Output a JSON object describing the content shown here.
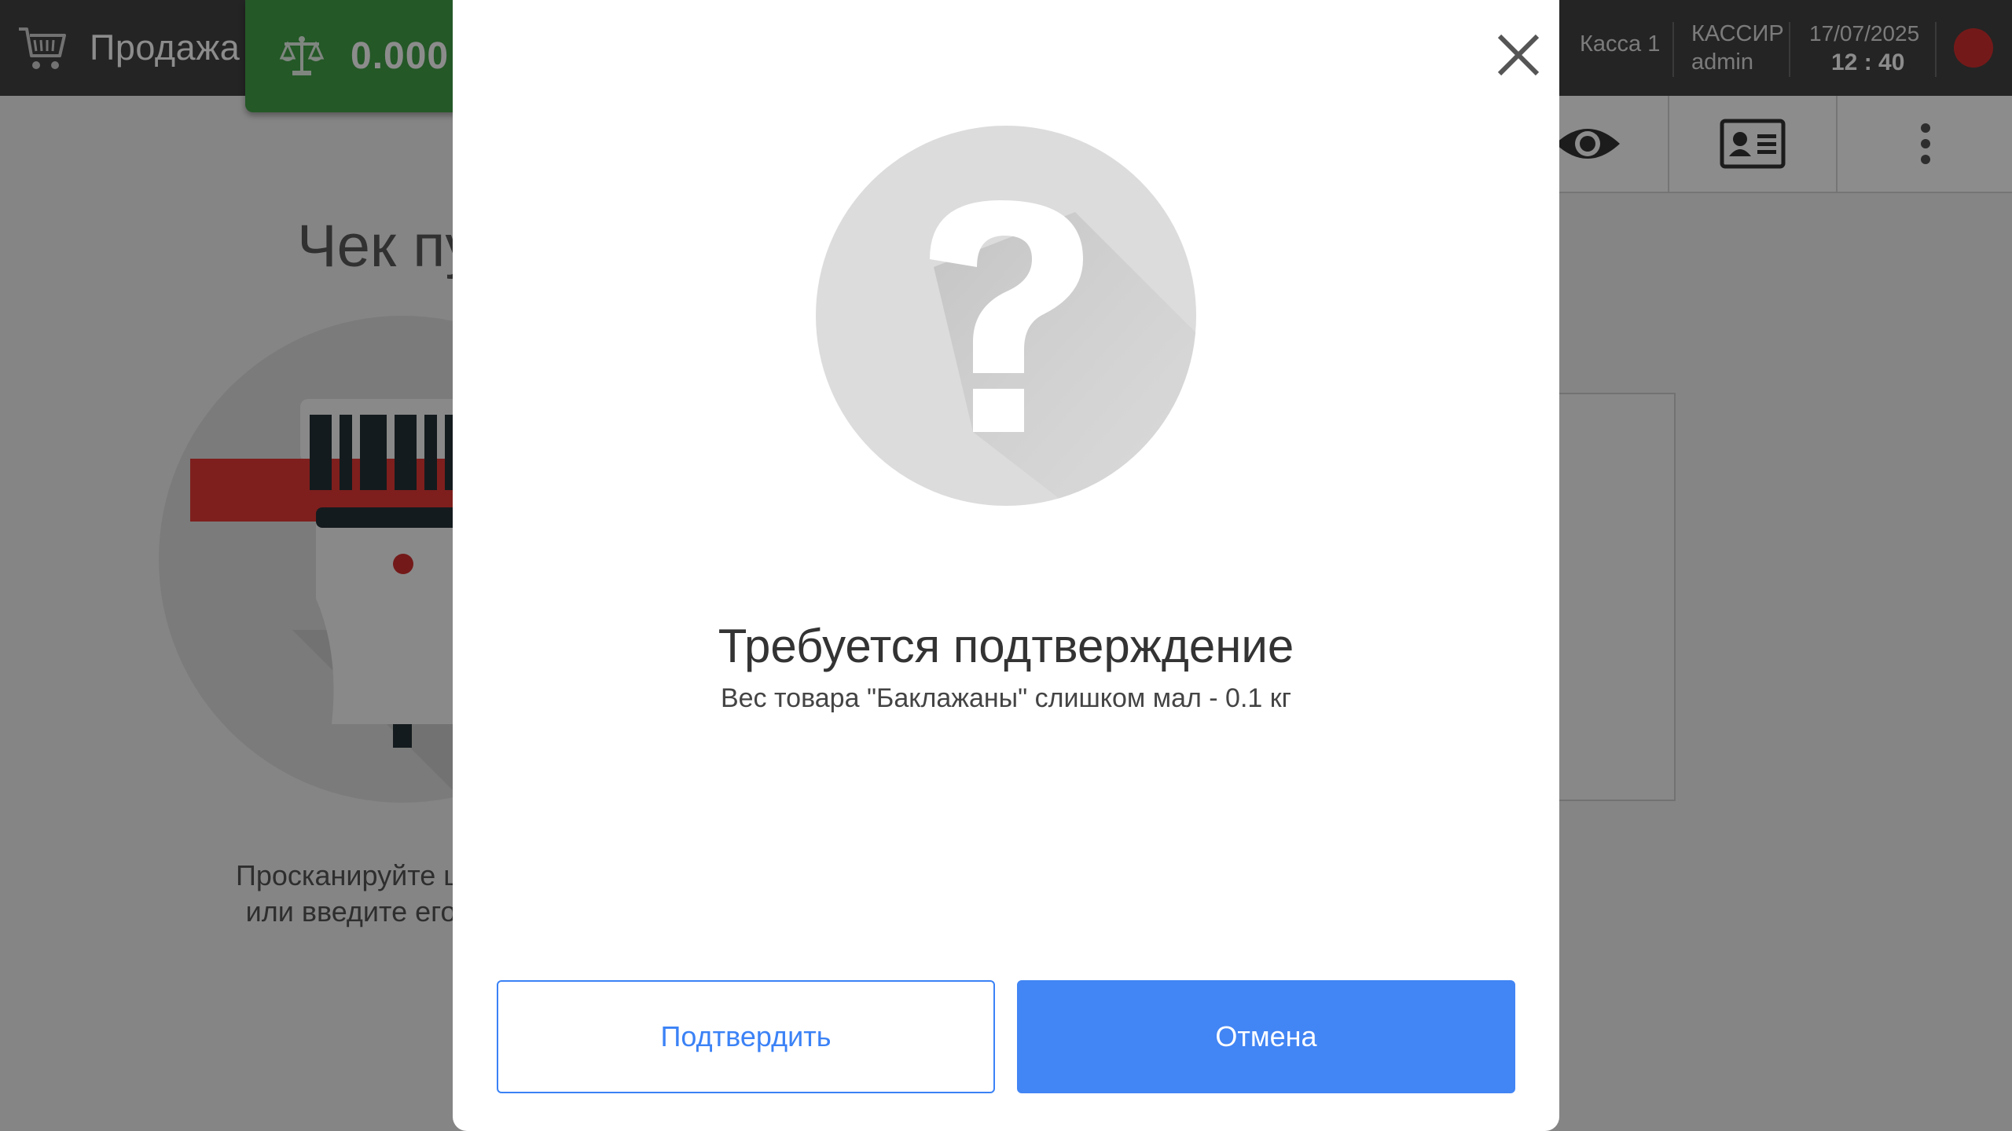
{
  "header": {
    "title": "Продажа",
    "cart_icon": "shopping-cart-icon",
    "scale": {
      "icon": "scale-icon",
      "value": "0.000",
      "color": "#43a047"
    },
    "register": "Касса 1",
    "cashier_caption": "КАССИР",
    "cashier_name": "admin",
    "date": "17/07/2025",
    "time": "12 : 40",
    "status_color": "#d32f2f"
  },
  "toolbar": {
    "icons": [
      "eye-icon",
      "id-card-icon",
      "more-vert-icon"
    ]
  },
  "background": {
    "title": "Чек пу",
    "hint_line1": "Просканируйте ш",
    "hint_line2": "или введите его"
  },
  "dialog": {
    "icon": "question-icon",
    "title": "Требуется подтверждение",
    "message": "Вес товара \"Баклажаны\" слишком мал - 0.1 кг",
    "confirm_label": "Подтвердить",
    "cancel_label": "Отмена",
    "accent_color": "#4285f4"
  }
}
